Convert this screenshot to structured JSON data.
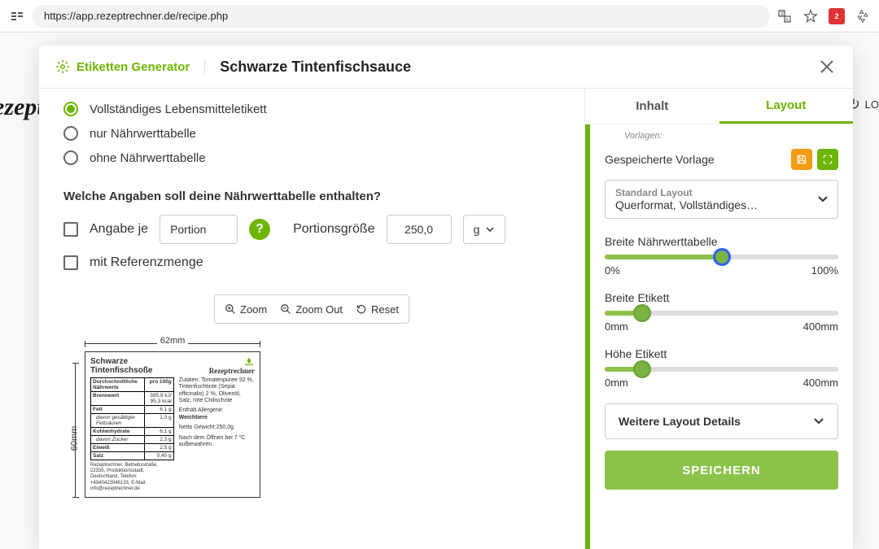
{
  "browser": {
    "url": "https://app.rezeptrechner.de/recipe.php",
    "ext_badge": "2"
  },
  "backdrop": {
    "logo": "ezeptr",
    "login": "LO"
  },
  "modal": {
    "generator_label": "Etiketten Generator",
    "title": "Schwarze Tintenfischsauce"
  },
  "radios": {
    "opt1": "Vollständiges Lebensmitteletikett",
    "opt2": "nur Nährwerttabelle",
    "opt3": "ohne Nährwerttabelle"
  },
  "question": "Welche Angaben soll deine Nährwerttabelle enthalten?",
  "controls": {
    "angabe_je": "Angabe je",
    "portion": "Portion",
    "portionsgroesse": "Portionsgröße",
    "portion_value": "250,0",
    "unit": "g",
    "mit_ref": "mit Referenzmenge"
  },
  "zoom": {
    "in": "Zoom",
    "out": "Zoom Out",
    "reset": "Reset"
  },
  "ruler": {
    "w": "62mm",
    "h": "60mm"
  },
  "preview": {
    "title": "Schwarze Tintenfischsoße",
    "brand": "Rezeptrechner",
    "table": {
      "head_l": "Durchschnittliche Nährwerte",
      "head_r": "pro 100g",
      "rows": [
        {
          "l": "Brennwert",
          "r1": "395,9 kJ/",
          "r2": "95,3 kcal"
        },
        {
          "l": "Fett",
          "r": "6,1 g"
        },
        {
          "l": "davon gesättigte Fettsäuren",
          "r": "1,0 g",
          "sub": true
        },
        {
          "l": "Kohlenhydrate",
          "r": "6,1 g"
        },
        {
          "l": "davon Zucker",
          "r": "2,3 g",
          "sub": true
        },
        {
          "l": "Eiweiß",
          "r": "2,5 g"
        },
        {
          "l": "Salz",
          "r": "0,40 g"
        }
      ]
    },
    "zutaten": "Zutaten: Tomatenpüree 92 %, Tintenfischtinte (Sepia officinalis) 2 %, Olivenöl, Salz, rote Chilischote",
    "allergene": "Enthält Allergene:",
    "allergene_val": "Weichtiere",
    "netto": "Netto Gewicht:250,0g",
    "hinweis": "Nach dem Öffnen bei 7 °C aufbewahren.",
    "footer": "Rezeptrechner, Betriebsstraße, 22335, Produktionsstadt, Deutschland, Telefon: +4940423046133, E-Mail: info@rezeptrechner.de"
  },
  "tabs": {
    "inhalt": "Inhalt",
    "layout": "Layout"
  },
  "right": {
    "vorlagen": "Vorlagen:",
    "saved": "Gespeicherte Vorlage",
    "standard": "Standard Layout",
    "standard_val": "Querformat, Vollständiges…",
    "s1": {
      "label": "Breite Nährwerttabelle",
      "min": "0%",
      "max": "100%",
      "pos": 50
    },
    "s2": {
      "label": "Breite Etikett",
      "min": "0mm",
      "max": "400mm",
      "pos": 16
    },
    "s3": {
      "label": "Höhe Etikett",
      "min": "0mm",
      "max": "400mm",
      "pos": 16
    },
    "details": "Weitere Layout Details",
    "save": "SPEICHERN"
  }
}
